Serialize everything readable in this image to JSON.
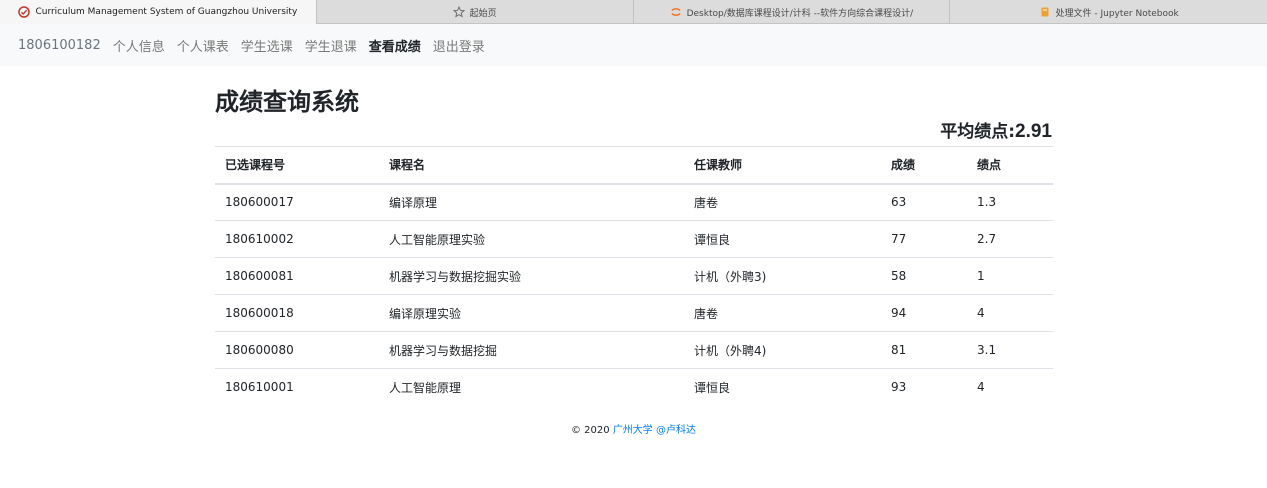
{
  "browser": {
    "tabs": [
      {
        "title": "Curriculum Management System of Guangzhou University",
        "icon": "app-logo-icon",
        "active": true
      },
      {
        "title": "起始页",
        "icon": "star-icon",
        "active": false
      },
      {
        "title": "Desktop/数据库课程设计/计科 --软件方向综合课程设计/",
        "icon": "jupyter-icon",
        "active": false
      },
      {
        "title": "处理文件 - Jupyter Notebook",
        "icon": "notebook-icon",
        "active": false
      }
    ]
  },
  "navbar": {
    "student_id": "1806100182",
    "links": [
      "个人信息",
      "个人课表",
      "学生选课",
      "学生退课",
      "查看成绩",
      "退出登录"
    ],
    "active_link": "查看成绩"
  },
  "main": {
    "title": "成绩查询系统",
    "gpa_label": "平均绩点:",
    "gpa_value": "2.91",
    "table": {
      "headers": [
        "已选课程号",
        "课程名",
        "任课教师",
        "成绩",
        "绩点"
      ],
      "rows": [
        [
          "180600017",
          "编译原理",
          "唐卷",
          "63",
          "1.3"
        ],
        [
          "180610002",
          "人工智能原理实验",
          "谭恒良",
          "77",
          "2.7"
        ],
        [
          "180600081",
          "机器学习与数据挖掘实验",
          "计机（外聘3)",
          "58",
          "1"
        ],
        [
          "180600018",
          "编译原理实验",
          "唐卷",
          "94",
          "4"
        ],
        [
          "180600080",
          "机器学习与数据挖掘",
          "计机（外聘4)",
          "81",
          "3.1"
        ],
        [
          "180610001",
          "人工智能原理",
          "谭恒良",
          "93",
          "4"
        ]
      ]
    }
  },
  "footer": {
    "copyright": "© 2020",
    "link_text": "广州大学 @卢科达"
  },
  "colors": {
    "link": "#007bff",
    "navbar_bg": "#f8f9fa",
    "tabbar_bg": "#dcdcdc"
  }
}
